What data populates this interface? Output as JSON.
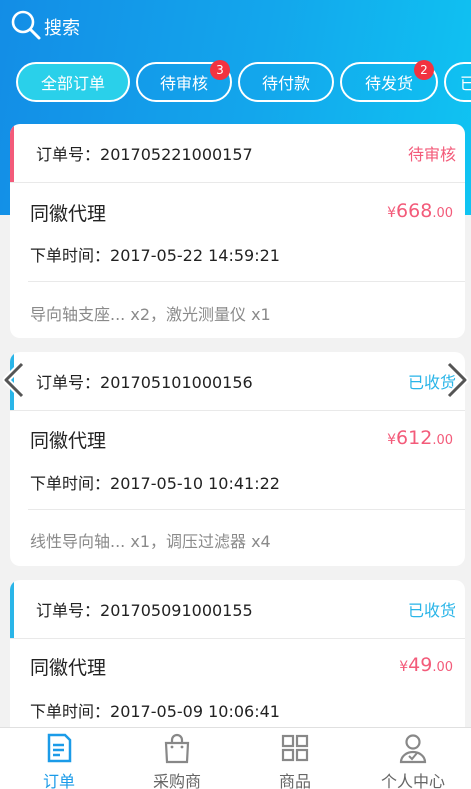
{
  "header": {
    "search_label": "搜索"
  },
  "tabs": [
    {
      "label": "全部订单",
      "active": true
    },
    {
      "label": "待审核",
      "badge": "3"
    },
    {
      "label": "待付款"
    },
    {
      "label": "待发货",
      "badge": "2"
    },
    {
      "label": "已"
    }
  ],
  "orders": [
    {
      "order_label": "订单号：",
      "order_no": "201705221000157",
      "status": "待审核",
      "status_color": "#f35b7a",
      "name": "同徽代理",
      "currency": "¥",
      "price_int": "668",
      "price_dec": ".00",
      "time_label": "下单时间：",
      "time": "2017-05-22 14:59:21",
      "items": "导向轴支座... x2，激光测量仪 x1"
    },
    {
      "order_label": "订单号：",
      "order_no": "201705101000156",
      "status": "已收货",
      "status_color": "#2ab5e8",
      "name": "同徽代理",
      "currency": "¥",
      "price_int": "612",
      "price_dec": ".00",
      "time_label": "下单时间：",
      "time": "2017-05-10 10:41:22",
      "items": "线性导向轴... x1，调压过滤器 x4"
    },
    {
      "order_label": "订单号：",
      "order_no": "201705091000155",
      "status": "已收货",
      "status_color": "#2ab5e8",
      "name": "同徽代理",
      "currency": "¥",
      "price_int": "49",
      "price_dec": ".00",
      "time_label": "下单时间：",
      "time": "2017-05-09 10:06:41"
    }
  ],
  "nav": [
    {
      "label": "订单",
      "icon": "order-icon",
      "active": true
    },
    {
      "label": "采购商",
      "icon": "bag-icon"
    },
    {
      "label": "商品",
      "icon": "grid-icon"
    },
    {
      "label": "个人中心",
      "icon": "user-icon"
    }
  ],
  "colors": {
    "accent": "#1b9be8",
    "pending": "#f35b7a",
    "received": "#2ab5e8",
    "badge": "#f23340"
  }
}
